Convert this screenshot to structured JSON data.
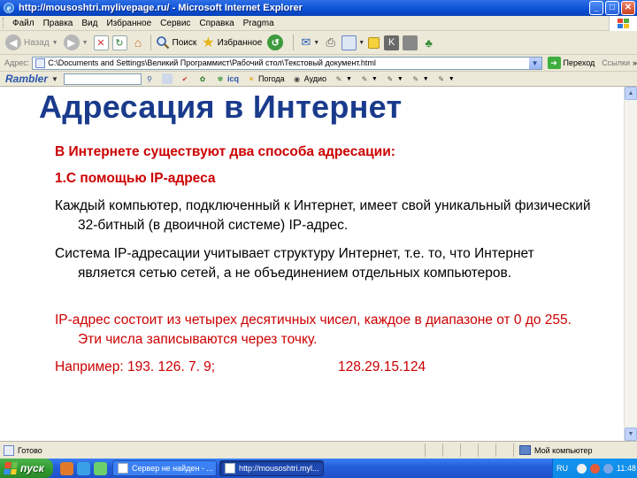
{
  "window": {
    "title": "http://mousoshtri.mylivepage.ru/ - Microsoft Internet Explorer",
    "buttons": {
      "minimize": "_",
      "maximize": "□",
      "close": "✕"
    }
  },
  "menu": {
    "items": [
      "Файл",
      "Правка",
      "Вид",
      "Избранное",
      "Сервис",
      "Справка",
      "Pragma"
    ]
  },
  "toolbar": {
    "back_label": "Назад",
    "search_label": "Поиск",
    "favorites_label": "Избранное"
  },
  "address": {
    "label": "Адрес:",
    "url": "C:\\Documents and Settings\\Великий Программист\\Рабочий стол\\Текстовый документ.html",
    "go_label": "Переход",
    "links_label": "Ссылки"
  },
  "rambler": {
    "logo": "Rambler",
    "items": [
      "Погода",
      "Аудио"
    ],
    "icq_label": "icq"
  },
  "slide": {
    "title": "Адресация в Интернет",
    "intro": "В Интернете существуют два способа адресации:",
    "method1": "1.С помощью IP-адреса",
    "para1": "Каждый компьютер, подключенный к Интернет, имеет свой уникальный физический 32-битный (в двоичной системе) IP-адрес.",
    "para2": "Система IP-адресации учитывает структуру Интернет, т.е. то, что Интернет является сетью сетей, а не объединением отдельных компьютеров.",
    "para3": "IP-адрес состоит из четырех десятичных чисел, каждое в диапазоне от 0 до 255. Эти числа записываются через точку.",
    "example_label": "Например: 193. 126. 7. 9;",
    "example_second": "128.29.15.124"
  },
  "status": {
    "text": "Готово",
    "zone": "Мой компьютер"
  },
  "taskbar": {
    "start_label": "пуск",
    "tasks": [
      "Сервер не найден - ...",
      "http://mousoshtri.myl..."
    ],
    "lang": "RU",
    "clock": "11:48"
  },
  "colors": {
    "title_blue": "#1a3b8c",
    "red_text": "#cc0000",
    "xp_blue": "#0a4fd6",
    "start_green": "#2f9a2f"
  }
}
